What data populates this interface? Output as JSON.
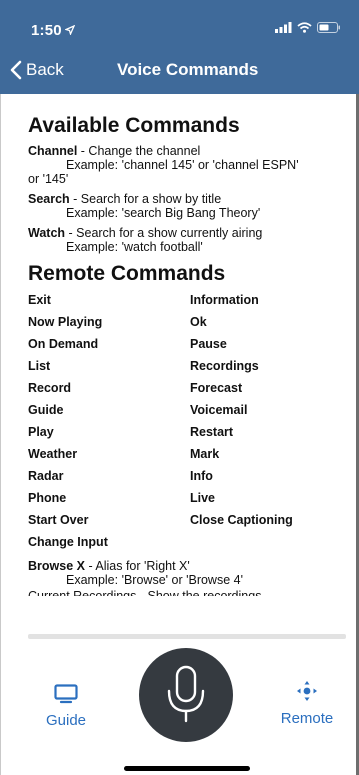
{
  "status": {
    "time": "1:50"
  },
  "nav": {
    "back_label": "Back",
    "title": "Voice Commands"
  },
  "available": {
    "heading": "Available Commands",
    "commands": [
      {
        "name": "Channel",
        "desc": " - Change the channel",
        "example": "Example: 'channel 145' or 'channel ESPN'",
        "example_wrap": "or '145'"
      },
      {
        "name": "Search",
        "desc": " - Search for a show by title",
        "example": "Example: 'search Big Bang Theory'"
      },
      {
        "name": "Watch",
        "desc": " - Search for a show currently airing",
        "example": "Example: 'watch football'"
      }
    ]
  },
  "remote": {
    "heading": "Remote Commands",
    "items": [
      "Exit",
      "Information",
      "Now Playing",
      "Ok",
      "On Demand",
      "Pause",
      "List",
      "Recordings",
      "Record",
      "Forecast",
      "Guide",
      "Voicemail",
      "Play",
      "Restart",
      "Weather",
      "Mark",
      "Radar",
      "Info",
      "Phone",
      "Live",
      "Start Over",
      "Close Captioning",
      "Change Input",
      ""
    ],
    "alias": {
      "name": "Browse X",
      "desc": " - Alias for 'Right X'",
      "example": "Example: 'Browse' or 'Browse 4'"
    },
    "cut_text": "Current Recordings - Show the recordings"
  },
  "bottom": {
    "guide_label": "Guide",
    "remote_label": "Remote"
  },
  "colors": {
    "header": "#3f6a9a",
    "accent": "#2b6fbf",
    "mic": "#353a40"
  }
}
